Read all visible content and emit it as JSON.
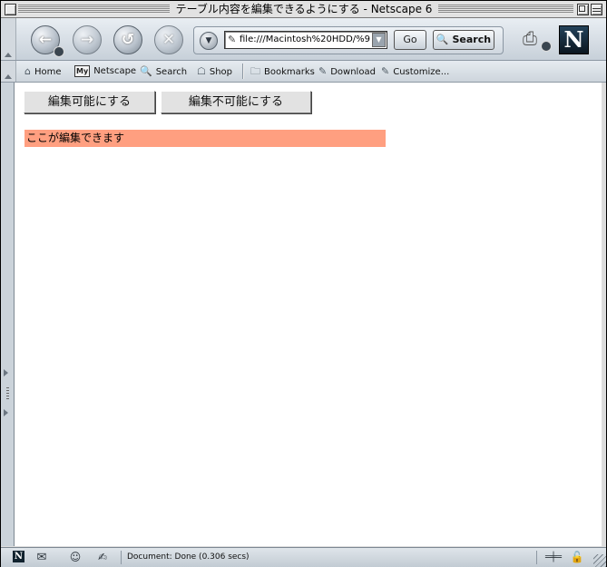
{
  "window": {
    "title": "テーブル内容を編集できるようにする - Netscape 6"
  },
  "nav": {
    "back_icon": "back-arrow-icon",
    "forward_icon": "forward-arrow-icon",
    "reload_icon": "reload-icon",
    "stop_icon": "stop-icon",
    "url": "file:///Macintosh%20HDD/%9",
    "go_label": "Go",
    "search_label": "Search"
  },
  "personal_toolbar": {
    "home": "Home",
    "my_badge": "My",
    "netscape": "Netscape",
    "search": "Search",
    "shop": "Shop",
    "bookmarks": "Bookmarks",
    "download": "Download",
    "customize": "Customize..."
  },
  "page": {
    "enable_button": "編集可能にする",
    "disable_button": "編集不可能にする",
    "editable_text": "ここが編集できます",
    "editable_bg": "#ff9f80"
  },
  "status": {
    "text": "Document: Done (0.306 secs)"
  }
}
